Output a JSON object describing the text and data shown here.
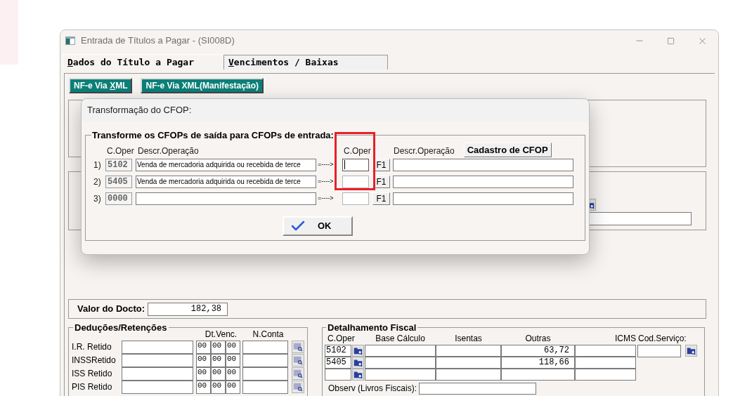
{
  "window": {
    "title": "Entrada de Títulos a Pagar - (SI008D)"
  },
  "tabs": [
    {
      "access_key": "D",
      "label_rest": "ados do Título a Pagar",
      "selected": true
    },
    {
      "access_key": "V",
      "label_rest": "encimentos / Baixas",
      "selected": false
    }
  ],
  "toolbar_buttons": [
    {
      "label": "NF-e Via ",
      "access_key": "X",
      "label_rest": "ML"
    },
    {
      "label": "NF-e Via XML(Manifestação)"
    }
  ],
  "document_value": {
    "label": "Valor do Docto:",
    "value": "182,38"
  },
  "deductions": {
    "title": "Deduções/Retenções",
    "columns": [
      "Dt.Venc.",
      "N.Conta"
    ],
    "rows": [
      {
        "label": "I.R. Retido",
        "date": [
          "00",
          "00",
          "00"
        ]
      },
      {
        "label": "INSSRetido",
        "date": [
          "00",
          "00",
          "00"
        ]
      },
      {
        "label": "ISS Retido",
        "date": [
          "00",
          "00",
          "00"
        ]
      },
      {
        "label": "PIS Retido",
        "date": [
          "00",
          "00",
          "00"
        ]
      }
    ]
  },
  "fiscal_detail": {
    "title": "Detalhamento Fiscal",
    "columns": [
      "C.Oper",
      "Base Cálculo",
      "Isentas",
      "Outras",
      "ICMS"
    ],
    "service_code_label": "Cod.Serviço:",
    "rows": [
      {
        "kind": "entry",
        "c_oper": "5102",
        "other": "63,72"
      },
      {
        "kind": "entry",
        "c_oper": "5405",
        "other": "118,66"
      },
      {
        "kind": "blank"
      }
    ],
    "notes_label": "Observ (Livros Fiscais):"
  },
  "dialog": {
    "title": "Transformação do CFOP:",
    "group_title": "Transforme os CFOPs de saída para CFOPs de entrada:",
    "headers": [
      "C.Oper",
      "Descr.Operação",
      "C.Oper",
      "Descr.Operação"
    ],
    "register_button": "Cadastro de CFOP",
    "rows": [
      {
        "index": "1)",
        "code": "5102",
        "description": "Venda de mercadoria adquirida ou recebida de terce",
        "arrow": "=---->",
        "lookup": "F1",
        "focused": true
      },
      {
        "index": "2)",
        "code": "5405",
        "description": "Venda de mercadoria adquirida ou recebida de terce",
        "arrow": "=---->",
        "lookup": "F1",
        "focused": false
      },
      {
        "index": "3)",
        "code": "0000",
        "arrow": "=---->",
        "lookup": "F1",
        "focused": false
      }
    ],
    "ok_button": "OK"
  }
}
